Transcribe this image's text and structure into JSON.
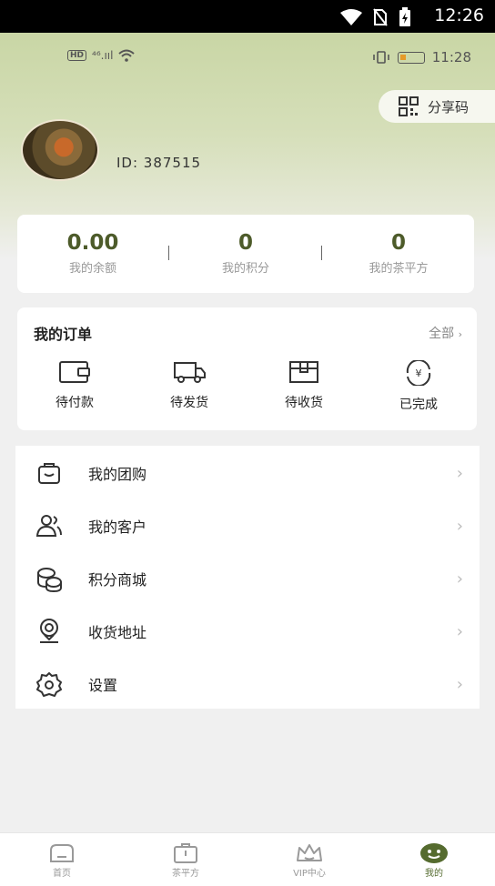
{
  "system_bar": {
    "time": "12:26"
  },
  "inner_status": {
    "hd": "HD",
    "signal": "⁴⁶.ııl",
    "time": "11:28"
  },
  "header": {
    "share_label": "分享码",
    "user_id": "ID:  387515"
  },
  "stats": [
    {
      "value": "0.00",
      "label": "我的余额"
    },
    {
      "value": "0",
      "label": "我的积分"
    },
    {
      "value": "0",
      "label": "我的茶平方"
    }
  ],
  "orders": {
    "title": "我的订单",
    "all_label": "全部",
    "items": [
      {
        "label": "待付款",
        "icon": "wallet-icon"
      },
      {
        "label": "待发货",
        "icon": "truck-icon"
      },
      {
        "label": "待收货",
        "icon": "package-icon"
      },
      {
        "label": "已完成",
        "icon": "yuan-cycle-icon"
      }
    ]
  },
  "menu": [
    {
      "label": "我的团购",
      "icon": "group-buy-bag-icon"
    },
    {
      "label": "我的客户",
      "icon": "customers-icon"
    },
    {
      "label": "积分商城",
      "icon": "coins-icon"
    },
    {
      "label": "收货地址",
      "icon": "location-pin-icon"
    },
    {
      "label": "设置",
      "icon": "gear-icon"
    }
  ],
  "tabbar": [
    {
      "label": "首页",
      "icon": "home-icon",
      "active": false
    },
    {
      "label": "茶平方",
      "icon": "tea-bag-icon",
      "active": false
    },
    {
      "label": "VIP中心",
      "icon": "crown-icon",
      "active": false
    },
    {
      "label": "我的",
      "icon": "smiley-icon",
      "active": true
    }
  ],
  "colors": {
    "accent": "#4d5b2a",
    "header_green": "#c9d6a5",
    "active_tab": "#556b2f"
  }
}
